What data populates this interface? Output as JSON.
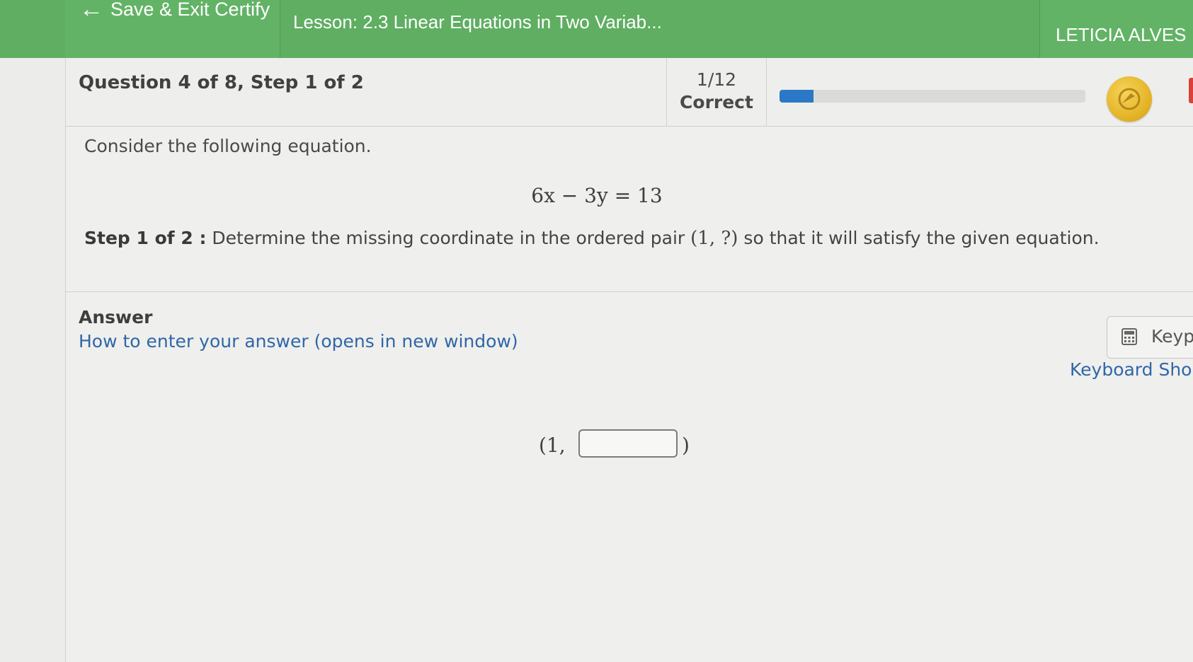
{
  "topbar": {
    "save_exit_arrow": "←",
    "save_exit_label": "Save & Exit Certify",
    "lesson_label": "Lesson: 2.3 Linear Equations in Two Variab...",
    "user_name": "LETICIA ALVES"
  },
  "question": {
    "title": "Question 4 of 8, Step 1 of 2",
    "score_fraction": "1/12",
    "score_label": "Correct",
    "progress_fraction": 0.11,
    "progress_color": "#2a78c6",
    "medal_icon": "medal-icon",
    "medal_color": "#e2b021"
  },
  "problem": {
    "intro": "Consider the following equation.",
    "equation": "6x − 3y = 13",
    "step_label": "Step 1 of 2 :",
    "step_text_before": "Determine the missing coordinate in the ordered pair",
    "step_pair": "(1, ?)",
    "step_text_after": "so that it will satisfy the given equation."
  },
  "answer": {
    "heading": "Answer",
    "how_to_link": "How to enter your answer (opens in new window)",
    "keypad_button": "Keyp",
    "keyboard_shortcuts_link": "Keyboard Shor",
    "pair_open": "(1,",
    "pair_close": ")",
    "input_value": ""
  }
}
